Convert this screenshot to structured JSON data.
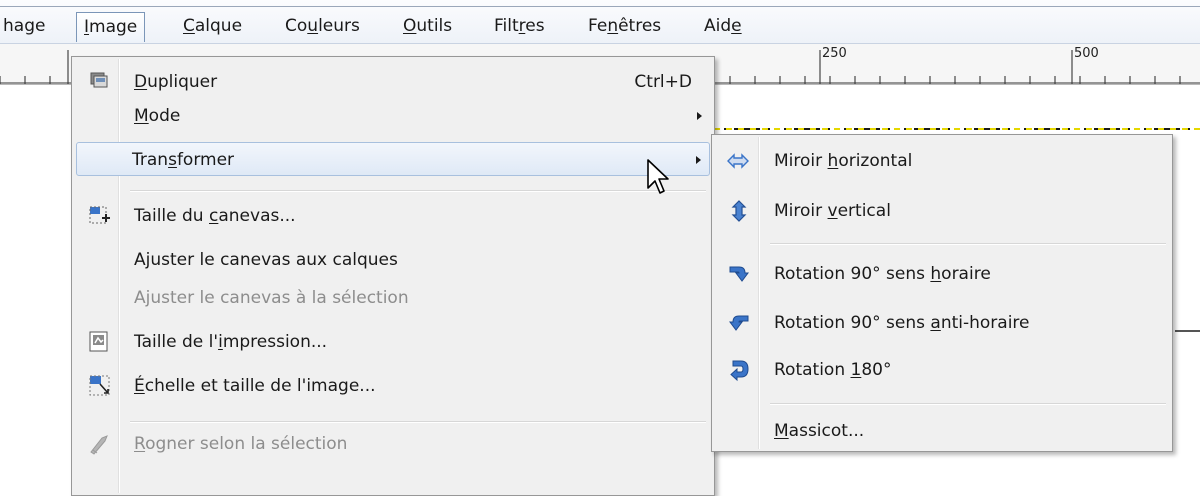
{
  "menubar": {
    "items": [
      {
        "text": "hage",
        "u": ""
      },
      {
        "text": "Image",
        "u": "I"
      },
      {
        "text": "Calque",
        "u": "C"
      },
      {
        "text": "Couleurs",
        "u": "u"
      },
      {
        "text": "Outils",
        "u": "O"
      },
      {
        "text": "Filtres",
        "u": "r"
      },
      {
        "text": "Fenêtres",
        "u": "n"
      },
      {
        "text": "Aide",
        "u": "e"
      }
    ]
  },
  "ruler": {
    "labels": [
      "250",
      "500"
    ]
  },
  "image_menu": {
    "items": [
      {
        "text": "Dupliquer",
        "u": "D",
        "accel": "Ctrl+D",
        "icon": "duplicate-icon",
        "state": "normal"
      },
      {
        "text": "Mode",
        "u": "M",
        "accel": "",
        "icon": "",
        "state": "submenu"
      },
      {
        "text": "Transformer",
        "u": "s",
        "accel": "",
        "icon": "",
        "state": "submenu-open"
      },
      {
        "text": "Taille du canevas...",
        "u": "c",
        "accel": "",
        "icon": "canvas-size-icon",
        "state": "normal"
      },
      {
        "text": "Ajuster le canevas aux calques",
        "u": "",
        "accel": "",
        "icon": "",
        "state": "normal"
      },
      {
        "text": "Ajuster le canevas à la sélection",
        "u": "",
        "accel": "",
        "icon": "",
        "state": "disabled"
      },
      {
        "text": "Taille de l'impression...",
        "u": "i",
        "accel": "",
        "icon": "print-size-icon",
        "state": "normal"
      },
      {
        "text": "Échelle et taille de l'image...",
        "u": "É",
        "accel": "",
        "icon": "scale-image-icon",
        "state": "normal"
      },
      {
        "text": "Rogner selon la sélection",
        "u": "R",
        "accel": "",
        "icon": "crop-icon",
        "state": "disabled"
      }
    ]
  },
  "transform_submenu": {
    "items": [
      {
        "text": "Miroir horizontal",
        "u": "h",
        "icon": "flip-horizontal-icon"
      },
      {
        "text": "Miroir vertical",
        "u": "v",
        "icon": "flip-vertical-icon"
      },
      {
        "text": "Rotation 90° sens horaire",
        "u": "h",
        "icon": "rotate-clockwise-icon"
      },
      {
        "text": "Rotation 90° sens anti-horaire",
        "u": "a",
        "icon": "rotate-counterclockwise-icon"
      },
      {
        "text": "Rotation 180°",
        "u": "1",
        "icon": "rotate-180-icon"
      },
      {
        "text": "Massicot...",
        "u": "M",
        "icon": ""
      }
    ]
  },
  "colors": {
    "menu_bg": "#f0f0f0",
    "hover_bg": "#dfe9f6",
    "disabled_text": "#8d8d8d",
    "icon_blue": "#3a74c8"
  }
}
